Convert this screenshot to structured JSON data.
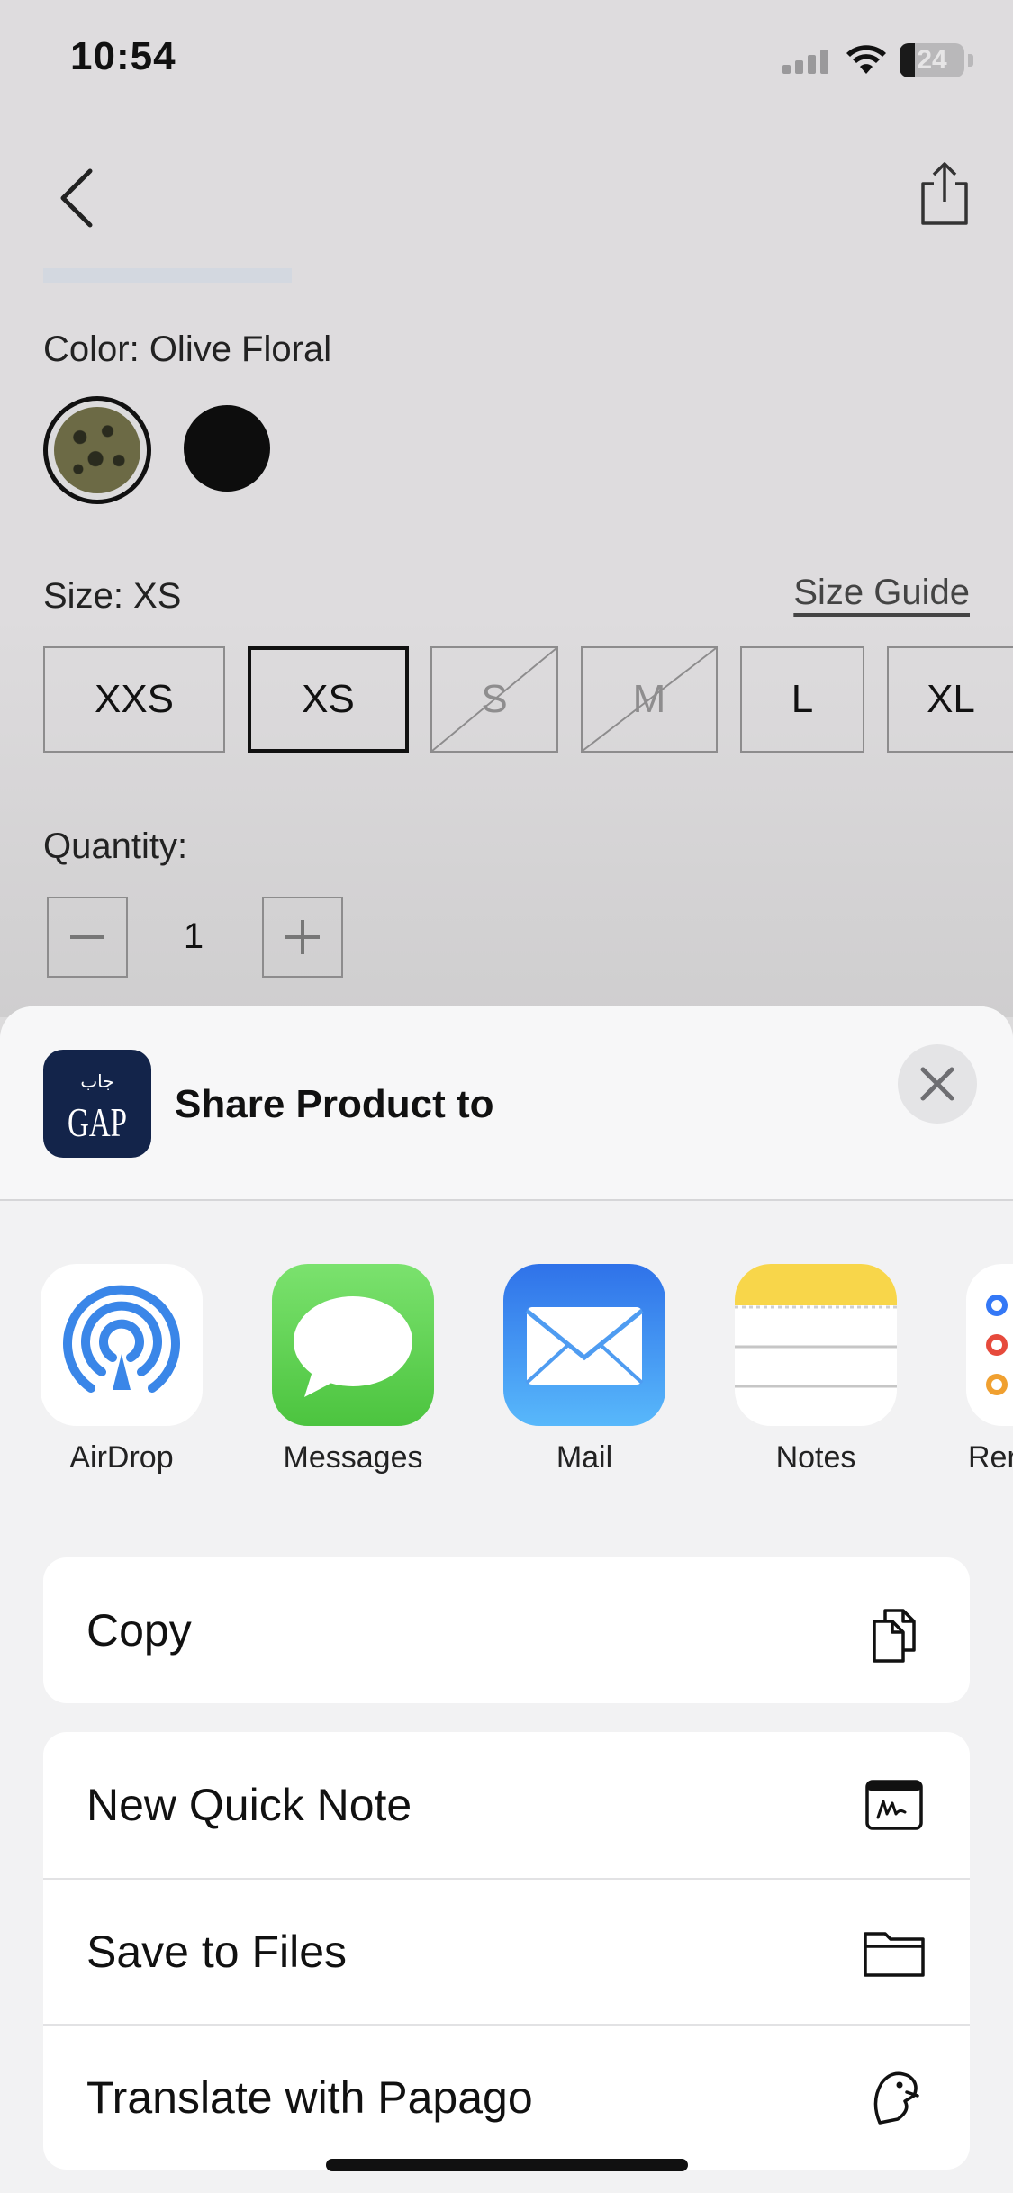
{
  "status_bar": {
    "time": "10:54",
    "battery_level": "24",
    "battery_percent": 24
  },
  "nav": {
    "back_icon": "chevron-left-icon",
    "share_icon": "share-icon"
  },
  "product": {
    "color_label": "Color: Olive Floral",
    "colors": [
      {
        "name": "Olive Floral",
        "hex": "#6c6a45",
        "selected": true
      },
      {
        "name": "Black",
        "hex": "#0d0d0d",
        "selected": false
      }
    ],
    "size_label": "Size: XS",
    "size_guide": "Size Guide",
    "sizes": [
      {
        "label": "XXS",
        "state": "available"
      },
      {
        "label": "XS",
        "state": "selected"
      },
      {
        "label": "S",
        "state": "unavailable"
      },
      {
        "label": "M",
        "state": "unavailable"
      },
      {
        "label": "L",
        "state": "available"
      },
      {
        "label": "XL",
        "state": "available"
      }
    ],
    "quantity_label": "Quantity:",
    "quantity": "1"
  },
  "share_sheet": {
    "title": "Share Product to",
    "app_logo_text": "GAP",
    "app_logo_arabic": "جاب",
    "apps": [
      {
        "label": "AirDrop",
        "icon": "airdrop-icon"
      },
      {
        "label": "Messages",
        "icon": "messages-icon"
      },
      {
        "label": "Mail",
        "icon": "mail-icon"
      },
      {
        "label": "Notes",
        "icon": "notes-icon"
      },
      {
        "label": "Rer",
        "icon": "reminders-icon"
      }
    ],
    "actions_group1": [
      {
        "label": "Copy",
        "icon": "copy-icon"
      }
    ],
    "actions_group2": [
      {
        "label": "New Quick Note",
        "icon": "quick-note-icon"
      },
      {
        "label": "Save to Files",
        "icon": "folder-icon"
      },
      {
        "label": "Translate with Papago",
        "icon": "papago-icon"
      }
    ]
  },
  "colors": {
    "accent_ios_blue": "#3478f6",
    "sheet_bg": "#f2f2f3",
    "dim_bg": "#dcdbdc"
  }
}
